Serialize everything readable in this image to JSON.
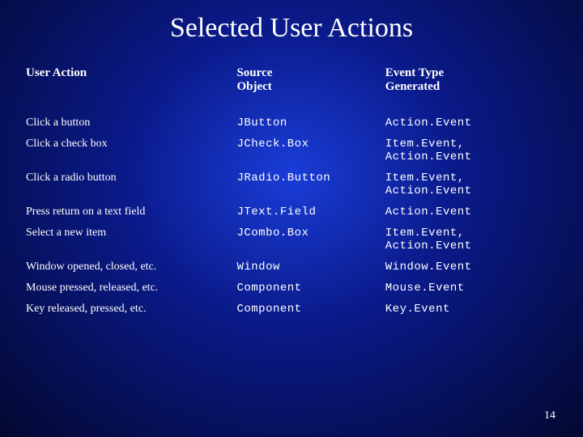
{
  "title": "Selected User Actions",
  "headers": {
    "col1": "User Action",
    "col2": "Source\nObject",
    "col3": "Event Type\nGenerated"
  },
  "rows": [
    {
      "action": "Click a button",
      "source": "JButton",
      "event": "Action.Event"
    },
    {
      "action": "Click a check box",
      "source": "JCheck.Box",
      "event": "Item.Event, Action.Event"
    },
    {
      "action": "Click a radio button",
      "source": "JRadio.Button",
      "event": "Item.Event, Action.Event"
    },
    {
      "action": "Press return on a text field",
      "source": "JText.Field",
      "event": "Action.Event"
    },
    {
      "action": "Select a new item",
      "source": "JCombo.Box",
      "event": "Item.Event, Action.Event"
    },
    {
      "action": "Window opened, closed, etc.",
      "source": "Window",
      "event": "Window.Event"
    },
    {
      "action": "Mouse pressed, released, etc.",
      "source": "Component",
      "event": "Mouse.Event"
    },
    {
      "action": "Key released, pressed, etc.",
      "source": "Component",
      "event": "Key.Event"
    }
  ],
  "page_number": "14",
  "chart_data": {
    "type": "table",
    "title": "Selected User Actions",
    "columns": [
      "User Action",
      "Source Object",
      "Event Type Generated"
    ],
    "rows": [
      [
        "Click a button",
        "JButton",
        "Action.Event"
      ],
      [
        "Click a check box",
        "JCheck.Box",
        "Item.Event, Action.Event"
      ],
      [
        "Click a radio button",
        "JRadio.Button",
        "Item.Event, Action.Event"
      ],
      [
        "Press return on a text field",
        "JText.Field",
        "Action.Event"
      ],
      [
        "Select a new item",
        "JCombo.Box",
        "Item.Event, Action.Event"
      ],
      [
        "Window opened, closed, etc.",
        "Window",
        "Window.Event"
      ],
      [
        "Mouse pressed, released, etc.",
        "Component",
        "Mouse.Event"
      ],
      [
        "Key released, pressed, etc.",
        "Component",
        "Key.Event"
      ]
    ]
  }
}
